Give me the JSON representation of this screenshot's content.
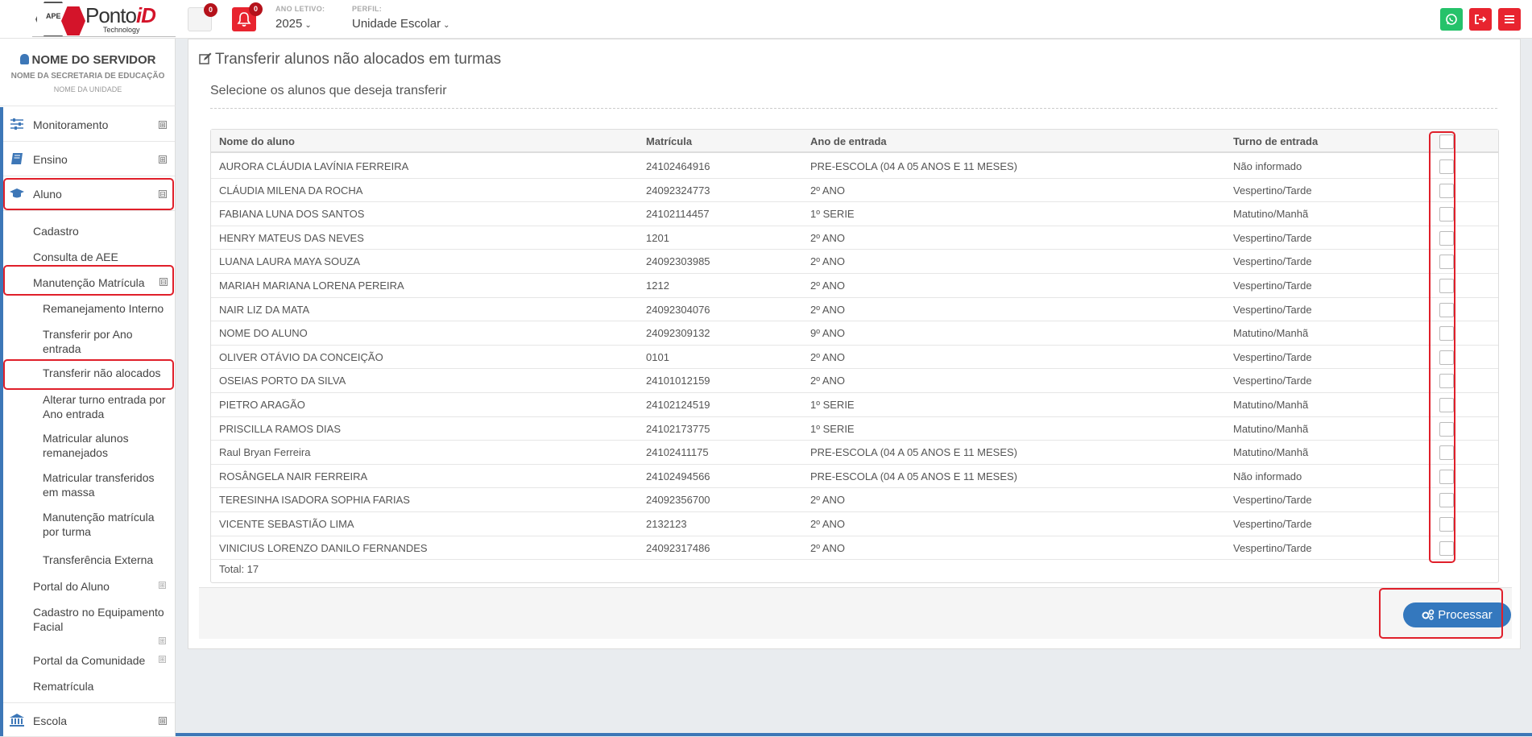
{
  "brand": {
    "mark": "APE",
    "name_prefix": "Ponto",
    "name_suffix": "iD",
    "tagline": "Technology"
  },
  "header": {
    "messages_count": "0",
    "notifications_count": "0",
    "ano_letivo_label": "ANO LETIVO:",
    "ano_letivo_value": "2025",
    "perfil_label": "PERFIL:",
    "perfil_value": "Unidade Escolar",
    "icons": [
      "whatsapp-icon",
      "logout-icon",
      "menu-icon"
    ]
  },
  "user": {
    "name": "NOME DO SERVIDOR",
    "secretaria": "NOME DA SECRETARIA DE EDUCAÇÃO",
    "unidade": "NOME DA UNIDADE"
  },
  "sidebar": {
    "monitoramento": "Monitoramento",
    "ensino": "Ensino",
    "aluno": "Aluno",
    "cadastro": "Cadastro",
    "consulta_aee": "Consulta de AEE",
    "manutencao_matricula": "Manutenção Matrícula",
    "remanejamento_interno": "Remanejamento Interno",
    "transferir_por_ano_1": "Transferir por Ano",
    "transferir_por_ano_2": "entrada",
    "transferir_nao_alocados": "Transferir não alocados",
    "alterar_turno_1": "Alterar turno entrada por",
    "alterar_turno_2": "Ano entrada",
    "matricular_remanejados_1": "Matricular alunos",
    "matricular_remanejados_2": "remanejados",
    "matricular_transferidos_1": "Matricular transferidos",
    "matricular_transferidos_2": "em massa",
    "manutencao_turma_1": "Manutenção matrícula",
    "manutencao_turma_2": "por turma",
    "transferencia_externa": "Transferência Externa",
    "portal_aluno": "Portal do Aluno",
    "cadastro_facial_1": "Cadastro no Equipamento",
    "cadastro_facial_2": "Facial",
    "portal_comunidade": "Portal da Comunidade",
    "rematricula": "Rematrícula",
    "escola": "Escola",
    "expand_symbol": "⊞",
    "collapse_symbol": "⊟"
  },
  "page": {
    "title": "Transferir alunos não alocados em turmas",
    "subtitle": "Selecione os alunos que deseja transferir",
    "columns": {
      "nome": "Nome do aluno",
      "matricula": "Matrícula",
      "ano": "Ano de entrada",
      "turno": "Turno de entrada"
    },
    "rows": [
      [
        "AURORA CLÁUDIA LAVÍNIA FERREIRA",
        "24102464916",
        "PRE-ESCOLA (04 A 05 ANOS E 11 MESES)",
        "Não informado"
      ],
      [
        "CLÁUDIA MILENA DA ROCHA",
        "24092324773",
        "2º ANO",
        "Vespertino/Tarde"
      ],
      [
        "FABIANA LUNA DOS SANTOS",
        "24102114457",
        "1º SERIE",
        "Matutino/Manhã"
      ],
      [
        "HENRY MATEUS DAS NEVES",
        "1201",
        "2º ANO",
        "Vespertino/Tarde"
      ],
      [
        "LUANA LAURA MAYA SOUZA",
        "24092303985",
        "2º ANO",
        "Vespertino/Tarde"
      ],
      [
        "MARIAH MARIANA LORENA PEREIRA",
        "1212",
        "2º ANO",
        "Vespertino/Tarde"
      ],
      [
        "NAIR LIZ DA MATA",
        "24092304076",
        "2º ANO",
        "Vespertino/Tarde"
      ],
      [
        "NOME DO ALUNO",
        "24092309132",
        "9º ANO",
        "Matutino/Manhã"
      ],
      [
        "OLIVER OTÁVIO DA CONCEIÇÃO",
        "0101",
        "2º ANO",
        "Vespertino/Tarde"
      ],
      [
        "OSEIAS PORTO DA SILVA",
        "24101012159",
        "2º ANO",
        "Vespertino/Tarde"
      ],
      [
        "PIETRO ARAGÃO",
        "24102124519",
        "1º SERIE",
        "Matutino/Manhã"
      ],
      [
        "PRISCILLA RAMOS DIAS",
        "24102173775",
        "1º SERIE",
        "Matutino/Manhã"
      ],
      [
        "Raul Bryan Ferreira",
        "24102411175",
        "PRE-ESCOLA (04 A 05 ANOS E 11 MESES)",
        "Matutino/Manhã"
      ],
      [
        "ROSÂNGELA NAIR FERREIRA",
        "24102494566",
        "PRE-ESCOLA (04 A 05 ANOS E 11 MESES)",
        "Não informado"
      ],
      [
        "TERESINHA ISADORA SOPHIA FARIAS",
        "24092356700",
        "2º ANO",
        "Vespertino/Tarde"
      ],
      [
        "VICENTE SEBASTIÃO LIMA",
        "2132123",
        "2º ANO",
        "Vespertino/Tarde"
      ],
      [
        "VINICIUS LORENZO DANILO FERNANDES",
        "24092317486",
        "2º ANO",
        "Vespertino/Tarde"
      ]
    ],
    "total": "Total: 17",
    "process_button": "Processar"
  },
  "colors": {
    "accent": "#3d77b7",
    "danger": "#e8242f",
    "whatsapp": "#25c26a",
    "highlight": "#e01f2a",
    "primary_button": "#3478be"
  }
}
